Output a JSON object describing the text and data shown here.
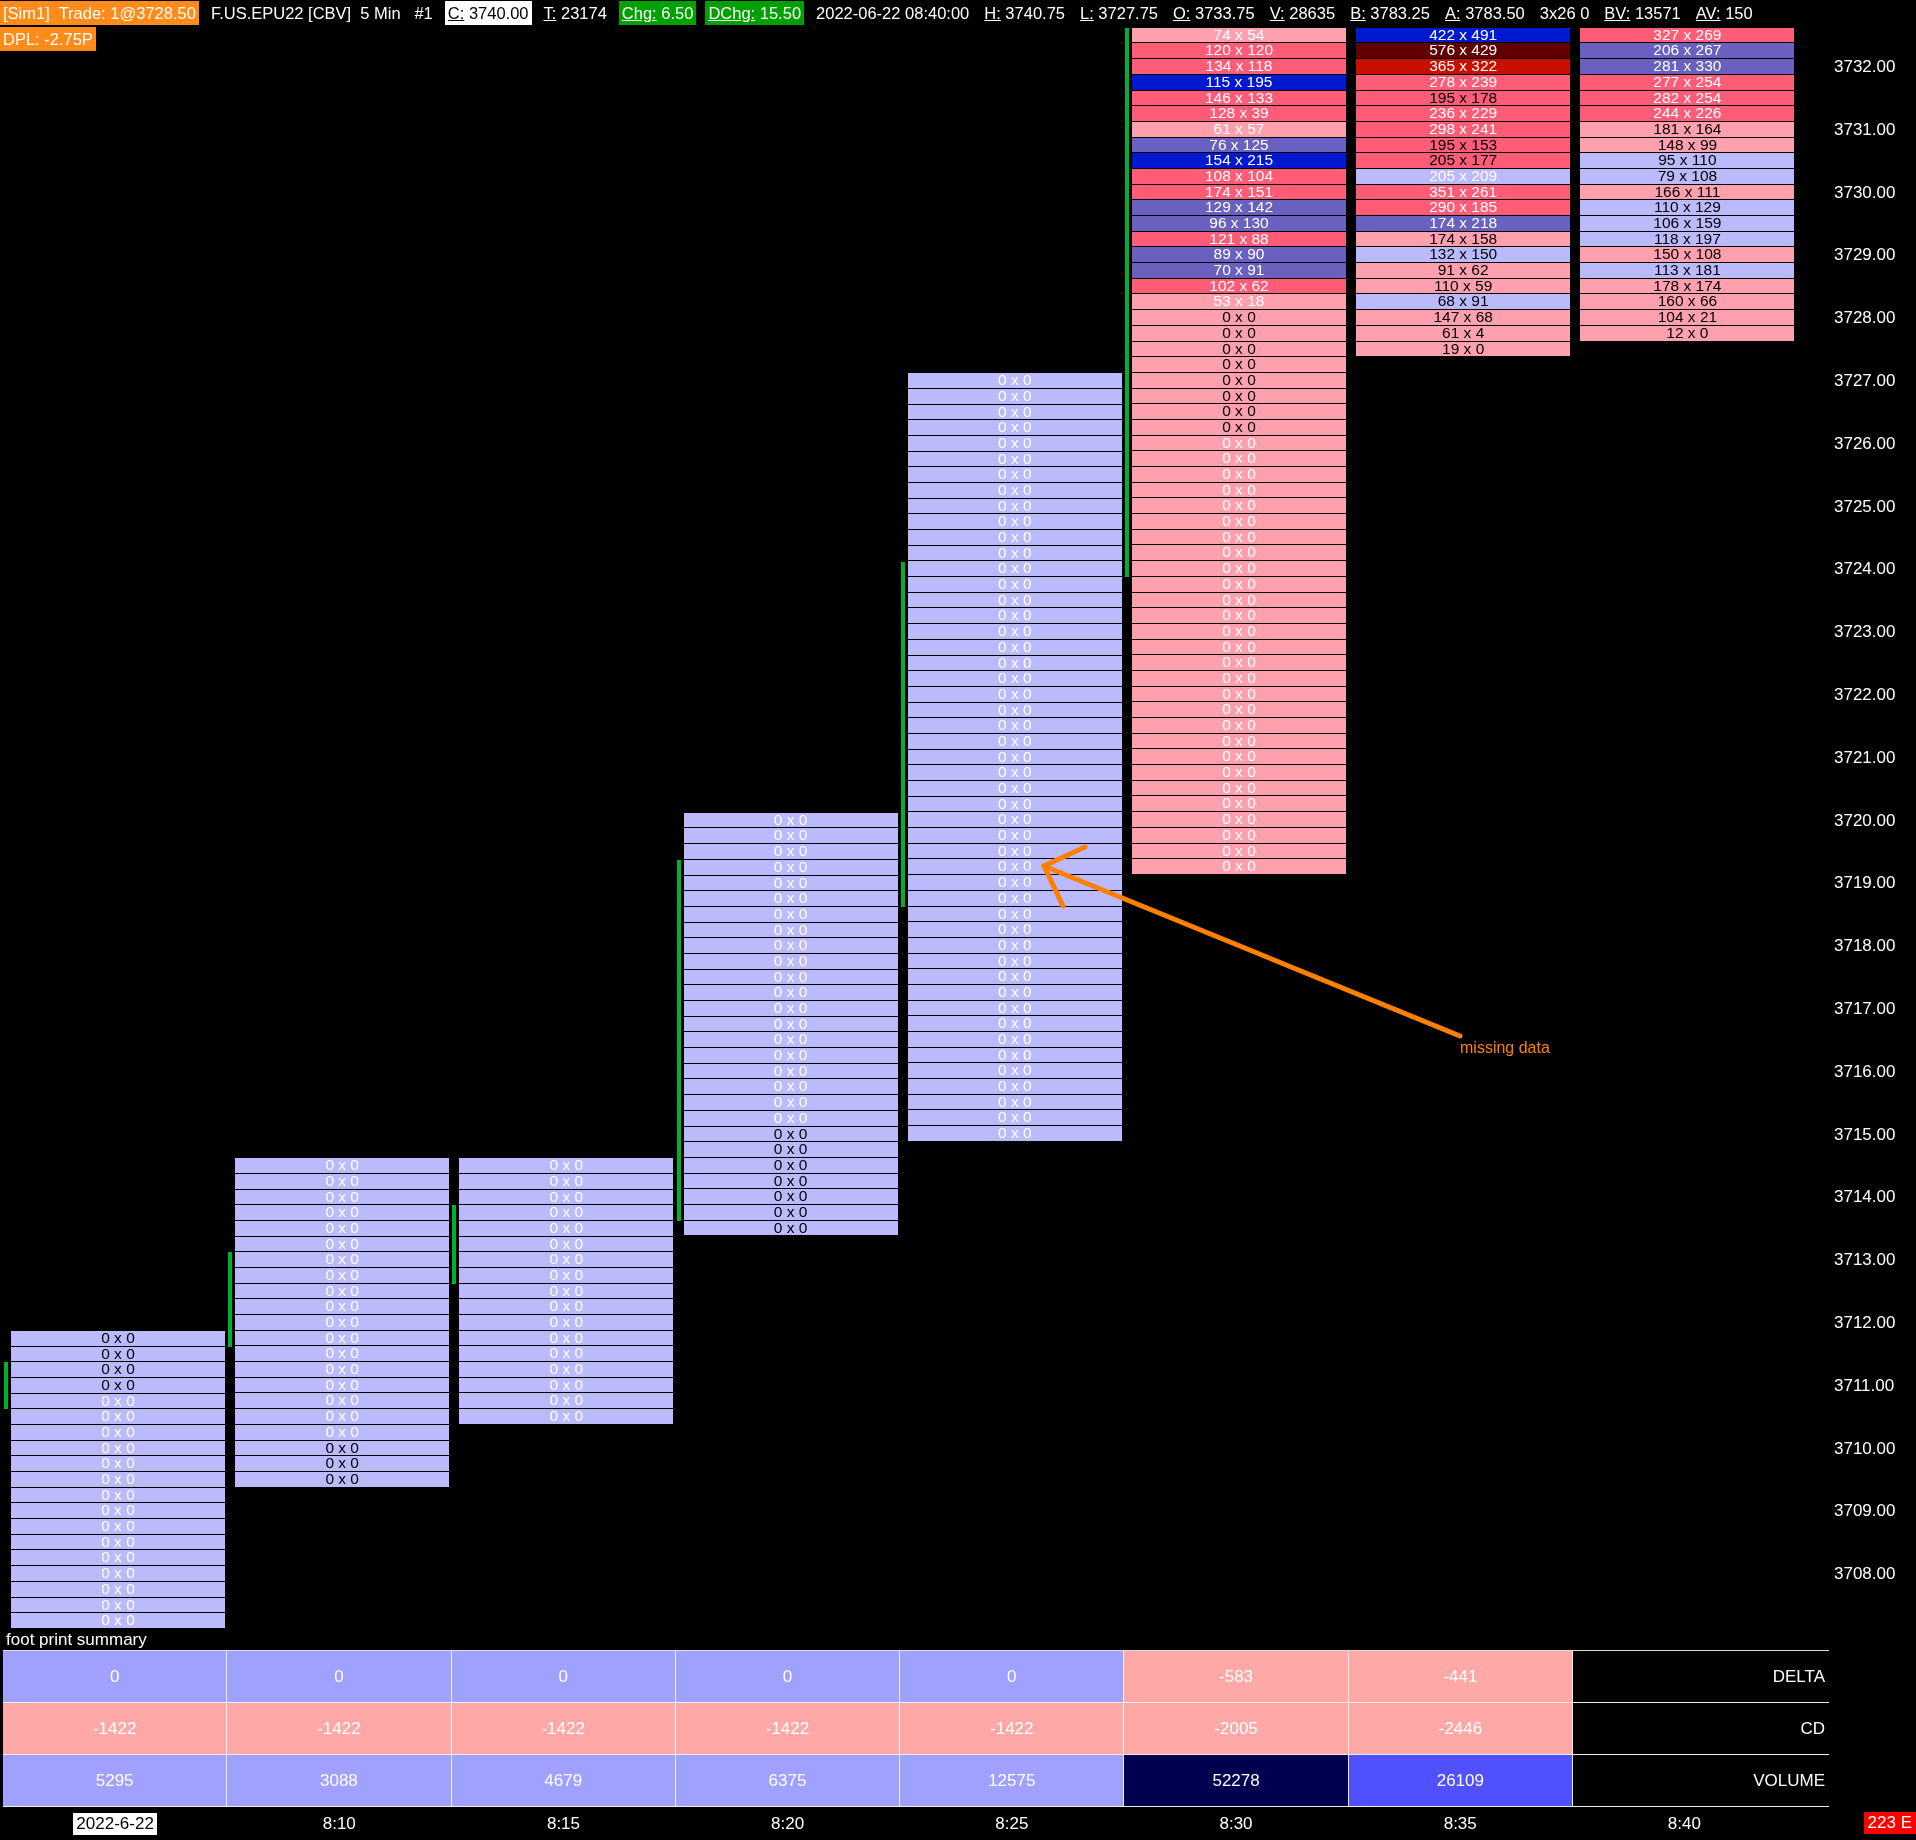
{
  "header": {
    "items": [
      {
        "value": "[Sim1]  Trade: 1@3728.50",
        "kind": "orange"
      },
      {
        "value": "F.US.EPU22 [CBV]  5 Min   #1",
        "kind": "plain"
      },
      {
        "label": "C:",
        "value": " 3740.00",
        "kind": "white"
      },
      {
        "label": "T:",
        "value": " 23174",
        "kind": "plain"
      },
      {
        "label": "Chg:",
        "value": " 6.50",
        "kind": "green"
      },
      {
        "label": "DChg:",
        "value": " 15.50",
        "kind": "green"
      },
      {
        "value": "2022-06-22 08:40:00",
        "kind": "plain"
      },
      {
        "label": "H:",
        "value": " 3740.75",
        "kind": "plain"
      },
      {
        "label": "L:",
        "value": " 3727.75",
        "kind": "plain"
      },
      {
        "label": "O:",
        "value": " 3733.75",
        "kind": "plain"
      },
      {
        "label": "V:",
        "value": " 28635",
        "kind": "plain"
      },
      {
        "label": "B:",
        "value": " 3783.25",
        "kind": "plain"
      },
      {
        "label": "A:",
        "value": " 3783.50",
        "kind": "plain"
      },
      {
        "value": "3x26 0",
        "kind": "plain"
      },
      {
        "label": "BV:",
        "value": " 13571",
        "kind": "plain"
      },
      {
        "label": "AV:",
        "value": " 150",
        "kind": "plain"
      }
    ],
    "second_line": {
      "value": "DPL: -2.75P",
      "kind": "orange"
    }
  },
  "bars": [
    {
      "cells": [
        {
          "text": "0 x 0",
          "color": "#babafc",
          "dark": true
        },
        {
          "text": "0 x 0",
          "color": "#babafc",
          "dark": true
        },
        {
          "text": "0 x 0",
          "color": "#babafc",
          "dark": true
        },
        {
          "text": "0 x 0",
          "color": "#babafc",
          "dark": true
        },
        {
          "text": "0 x 0",
          "color": "#babafc",
          "dark": false
        },
        {
          "text": "0 x 0",
          "color": "#babafc",
          "dark": false
        },
        {
          "text": "0 x 0",
          "color": "#babafc",
          "dark": false
        },
        {
          "text": "0 x 0",
          "color": "#babafc",
          "dark": false
        },
        {
          "text": "0 x 0",
          "color": "#babafc",
          "dark": false
        },
        {
          "text": "0 x 0",
          "color": "#babafc",
          "dark": false
        },
        {
          "text": "0 x 0",
          "color": "#babafc",
          "dark": false
        },
        {
          "text": "0 x 0",
          "color": "#babafc",
          "dark": false
        },
        {
          "text": "0 x 0",
          "color": "#babafc",
          "dark": false
        },
        {
          "text": "0 x 0",
          "color": "#babafc",
          "dark": false
        },
        {
          "text": "0 x 0",
          "color": "#babafc",
          "dark": false
        },
        {
          "text": "0 x 0",
          "color": "#babafc",
          "dark": false
        },
        {
          "text": "0 x 0",
          "color": "#babafc",
          "dark": false
        },
        {
          "text": "0 x 0",
          "color": "#babafc",
          "dark": false
        },
        {
          "text": "0 x 0",
          "color": "#babafc",
          "dark": false
        }
      ]
    },
    {
      "cells": [
        {
          "text": "0 x 0",
          "color": "#babafc",
          "dark": false
        },
        {
          "text": "0 x 0",
          "color": "#babafc",
          "dark": false
        },
        {
          "text": "0 x 0",
          "color": "#babafc",
          "dark": false
        },
        {
          "text": "0 x 0",
          "color": "#babafc",
          "dark": false
        },
        {
          "text": "0 x 0",
          "color": "#babafc",
          "dark": false
        },
        {
          "text": "0 x 0",
          "color": "#babafc",
          "dark": false
        },
        {
          "text": "0 x 0",
          "color": "#babafc",
          "dark": false
        },
        {
          "text": "0 x 0",
          "color": "#babafc",
          "dark": false
        },
        {
          "text": "0 x 0",
          "color": "#babafc",
          "dark": false
        },
        {
          "text": "0 x 0",
          "color": "#babafc",
          "dark": false
        },
        {
          "text": "0 x 0",
          "color": "#babafc",
          "dark": false
        },
        {
          "text": "0 x 0",
          "color": "#babafc",
          "dark": false
        },
        {
          "text": "0 x 0",
          "color": "#babafc",
          "dark": false
        },
        {
          "text": "0 x 0",
          "color": "#babafc",
          "dark": false
        },
        {
          "text": "0 x 0",
          "color": "#babafc",
          "dark": false
        },
        {
          "text": "0 x 0",
          "color": "#babafc",
          "dark": false
        },
        {
          "text": "0 x 0",
          "color": "#babafc",
          "dark": false
        },
        {
          "text": "0 x 0",
          "color": "#babafc",
          "dark": false
        },
        {
          "text": "0 x 0",
          "color": "#babafc",
          "dark": true
        },
        {
          "text": "0 x 0",
          "color": "#babafc",
          "dark": true
        },
        {
          "text": "0 x 0",
          "color": "#babafc",
          "dark": true
        }
      ]
    },
    {
      "cells": [
        {
          "text": "0 x 0",
          "color": "#babafc",
          "dark": false
        },
        {
          "text": "0 x 0",
          "color": "#babafc",
          "dark": false
        },
        {
          "text": "0 x 0",
          "color": "#babafc",
          "dark": false
        },
        {
          "text": "0 x 0",
          "color": "#babafc",
          "dark": false
        },
        {
          "text": "0 x 0",
          "color": "#babafc",
          "dark": false
        },
        {
          "text": "0 x 0",
          "color": "#babafc",
          "dark": false
        },
        {
          "text": "0 x 0",
          "color": "#babafc",
          "dark": false
        },
        {
          "text": "0 x 0",
          "color": "#babafc",
          "dark": false
        },
        {
          "text": "0 x 0",
          "color": "#babafc",
          "dark": false
        },
        {
          "text": "0 x 0",
          "color": "#babafc",
          "dark": false
        },
        {
          "text": "0 x 0",
          "color": "#babafc",
          "dark": false
        },
        {
          "text": "0 x 0",
          "color": "#babafc",
          "dark": false
        },
        {
          "text": "0 x 0",
          "color": "#babafc",
          "dark": false
        },
        {
          "text": "0 x 0",
          "color": "#babafc",
          "dark": false
        },
        {
          "text": "0 x 0",
          "color": "#babafc",
          "dark": false
        },
        {
          "text": "0 x 0",
          "color": "#babafc",
          "dark": false
        },
        {
          "text": "0 x 0",
          "color": "#babafc",
          "dark": false
        }
      ]
    },
    {
      "cells": [
        {
          "text": "0 x 0",
          "color": "#babafc",
          "dark": false
        },
        {
          "text": "0 x 0",
          "color": "#babafc",
          "dark": false
        },
        {
          "text": "0 x 0",
          "color": "#babafc",
          "dark": false
        },
        {
          "text": "0 x 0",
          "color": "#babafc",
          "dark": false
        },
        {
          "text": "0 x 0",
          "color": "#babafc",
          "dark": false
        },
        {
          "text": "0 x 0",
          "color": "#babafc",
          "dark": false
        },
        {
          "text": "0 x 0",
          "color": "#babafc",
          "dark": false
        },
        {
          "text": "0 x 0",
          "color": "#babafc",
          "dark": false
        },
        {
          "text": "0 x 0",
          "color": "#babafc",
          "dark": false
        },
        {
          "text": "0 x 0",
          "color": "#babafc",
          "dark": false
        },
        {
          "text": "0 x 0",
          "color": "#babafc",
          "dark": false
        },
        {
          "text": "0 x 0",
          "color": "#babafc",
          "dark": false
        },
        {
          "text": "0 x 0",
          "color": "#babafc",
          "dark": false
        },
        {
          "text": "0 x 0",
          "color": "#babafc",
          "dark": false
        },
        {
          "text": "0 x 0",
          "color": "#babafc",
          "dark": false
        },
        {
          "text": "0 x 0",
          "color": "#babafc",
          "dark": false
        },
        {
          "text": "0 x 0",
          "color": "#babafc",
          "dark": false
        },
        {
          "text": "0 x 0",
          "color": "#babafc",
          "dark": false
        },
        {
          "text": "0 x 0",
          "color": "#babafc",
          "dark": false
        },
        {
          "text": "0 x 0",
          "color": "#babafc",
          "dark": false
        },
        {
          "text": "0 x 0",
          "color": "#babafc",
          "dark": true
        },
        {
          "text": "0 x 0",
          "color": "#babafc",
          "dark": true
        },
        {
          "text": "0 x 0",
          "color": "#babafc",
          "dark": true
        },
        {
          "text": "0 x 0",
          "color": "#babafc",
          "dark": true
        },
        {
          "text": "0 x 0",
          "color": "#babafc",
          "dark": true
        },
        {
          "text": "0 x 0",
          "color": "#babafc",
          "dark": true
        },
        {
          "text": "0 x 0",
          "color": "#babafc",
          "dark": true
        }
      ]
    },
    {
      "cells": [
        {
          "text": "0 x 0",
          "color": "#babafc",
          "dark": false
        },
        {
          "text": "0 x 0",
          "color": "#babafc",
          "dark": false
        },
        {
          "text": "0 x 0",
          "color": "#babafc",
          "dark": false
        },
        {
          "text": "0 x 0",
          "color": "#babafc",
          "dark": false
        },
        {
          "text": "0 x 0",
          "color": "#babafc",
          "dark": false
        },
        {
          "text": "0 x 0",
          "color": "#babafc",
          "dark": false
        },
        {
          "text": "0 x 0",
          "color": "#babafc",
          "dark": false
        },
        {
          "text": "0 x 0",
          "color": "#babafc",
          "dark": false
        },
        {
          "text": "0 x 0",
          "color": "#babafc",
          "dark": false
        },
        {
          "text": "0 x 0",
          "color": "#babafc",
          "dark": false
        },
        {
          "text": "0 x 0",
          "color": "#babafc",
          "dark": false
        },
        {
          "text": "0 x 0",
          "color": "#babafc",
          "dark": false
        },
        {
          "text": "0 x 0",
          "color": "#babafc",
          "dark": false
        },
        {
          "text": "0 x 0",
          "color": "#babafc",
          "dark": false
        },
        {
          "text": "0 x 0",
          "color": "#babafc",
          "dark": false
        },
        {
          "text": "0 x 0",
          "color": "#babafc",
          "dark": false
        },
        {
          "text": "0 x 0",
          "color": "#babafc",
          "dark": false
        },
        {
          "text": "0 x 0",
          "color": "#babafc",
          "dark": false
        },
        {
          "text": "0 x 0",
          "color": "#babafc",
          "dark": false
        },
        {
          "text": "0 x 0",
          "color": "#babafc",
          "dark": false
        },
        {
          "text": "0 x 0",
          "color": "#babafc",
          "dark": false
        },
        {
          "text": "0 x 0",
          "color": "#babafc",
          "dark": false
        },
        {
          "text": "0 x 0",
          "color": "#babafc",
          "dark": false
        },
        {
          "text": "0 x 0",
          "color": "#babafc",
          "dark": false
        },
        {
          "text": "0 x 0",
          "color": "#babafc",
          "dark": false
        },
        {
          "text": "0 x 0",
          "color": "#babafc",
          "dark": false
        },
        {
          "text": "0 x 0",
          "color": "#babafc",
          "dark": false
        },
        {
          "text": "0 x 0",
          "color": "#babafc",
          "dark": false
        },
        {
          "text": "0 x 0",
          "color": "#babafc",
          "dark": false
        },
        {
          "text": "0 x 0",
          "color": "#babafc",
          "dark": false
        },
        {
          "text": "0 x 0",
          "color": "#babafc",
          "dark": false
        },
        {
          "text": "0 x 0",
          "color": "#babafc",
          "dark": false
        },
        {
          "text": "0 x 0",
          "color": "#babafc",
          "dark": false
        },
        {
          "text": "0 x 0",
          "color": "#babafc",
          "dark": false
        },
        {
          "text": "0 x 0",
          "color": "#babafc",
          "dark": false
        },
        {
          "text": "0 x 0",
          "color": "#babafc",
          "dark": false
        },
        {
          "text": "0 x 0",
          "color": "#babafc",
          "dark": false
        },
        {
          "text": "0 x 0",
          "color": "#babafc",
          "dark": false
        },
        {
          "text": "0 x 0",
          "color": "#babafc",
          "dark": false
        },
        {
          "text": "0 x 0",
          "color": "#babafc",
          "dark": false
        },
        {
          "text": "0 x 0",
          "color": "#babafc",
          "dark": false
        },
        {
          "text": "0 x 0",
          "color": "#babafc",
          "dark": false
        },
        {
          "text": "0 x 0",
          "color": "#babafc",
          "dark": false
        },
        {
          "text": "0 x 0",
          "color": "#babafc",
          "dark": false
        },
        {
          "text": "0 x 0",
          "color": "#babafc",
          "dark": false
        },
        {
          "text": "0 x 0",
          "color": "#babafc",
          "dark": false
        },
        {
          "text": "0 x 0",
          "color": "#babafc",
          "dark": false
        },
        {
          "text": "0 x 0",
          "color": "#babafc",
          "dark": false
        },
        {
          "text": "0 x 0",
          "color": "#babafc",
          "dark": false
        }
      ]
    },
    {
      "cells": [
        {
          "text": "74 x 54",
          "color": "#ffa0ae",
          "dark": false
        },
        {
          "text": "120 x 120",
          "color": "#ff5c78",
          "dark": false
        },
        {
          "text": "134 x 118",
          "color": "#ff5c78",
          "dark": false
        },
        {
          "text": "115 x 195",
          "color": "#0018d0",
          "dark": false
        },
        {
          "text": "146 x 133",
          "color": "#ff5c78",
          "dark": false
        },
        {
          "text": "128 x 39",
          "color": "#ff5c78",
          "dark": false
        },
        {
          "text": "61 x 57",
          "color": "#ffa0ae",
          "dark": false
        },
        {
          "text": "76 x 125",
          "color": "#6a60c0",
          "dark": false
        },
        {
          "text": "154 x 215",
          "color": "#0018d0",
          "dark": false
        },
        {
          "text": "108 x 104",
          "color": "#ff5c78",
          "dark": false
        },
        {
          "text": "174 x 151",
          "color": "#ff5c78",
          "dark": false
        },
        {
          "text": "129 x 142",
          "color": "#6a60c0",
          "dark": false
        },
        {
          "text": "96 x 130",
          "color": "#6a60c0",
          "dark": false
        },
        {
          "text": "121 x 88",
          "color": "#ff5c78",
          "dark": false
        },
        {
          "text": "89 x 90",
          "color": "#6a60c0",
          "dark": false
        },
        {
          "text": "70 x 91",
          "color": "#6a60c0",
          "dark": false
        },
        {
          "text": "102 x 62",
          "color": "#ff5c78",
          "dark": false
        },
        {
          "text": "53 x 18",
          "color": "#ffa0ae",
          "dark": false
        },
        {
          "text": "0 x 0",
          "color": "#ffa0ae",
          "dark": true
        },
        {
          "text": "0 x 0",
          "color": "#ffa0ae",
          "dark": true
        },
        {
          "text": "0 x 0",
          "color": "#ffa0ae",
          "dark": true
        },
        {
          "text": "0 x 0",
          "color": "#ffa0ae",
          "dark": true
        },
        {
          "text": "0 x 0",
          "color": "#ffa0ae",
          "dark": true
        },
        {
          "text": "0 x 0",
          "color": "#ffa0ae",
          "dark": true
        },
        {
          "text": "0 x 0",
          "color": "#ffa0ae",
          "dark": true
        },
        {
          "text": "0 x 0",
          "color": "#ffa0ae",
          "dark": true
        },
        {
          "text": "0 x 0",
          "color": "#ffa0ae",
          "dark": false
        },
        {
          "text": "0 x 0",
          "color": "#ffa0ae",
          "dark": false
        },
        {
          "text": "0 x 0",
          "color": "#ffa0ae",
          "dark": false
        },
        {
          "text": "0 x 0",
          "color": "#ffa0ae",
          "dark": false
        },
        {
          "text": "0 x 0",
          "color": "#ffa0ae",
          "dark": false
        },
        {
          "text": "0 x 0",
          "color": "#ffa0ae",
          "dark": false
        },
        {
          "text": "0 x 0",
          "color": "#ffa0ae",
          "dark": false
        },
        {
          "text": "0 x 0",
          "color": "#ffa0ae",
          "dark": false
        },
        {
          "text": "0 x 0",
          "color": "#ffa0ae",
          "dark": false
        },
        {
          "text": "0 x 0",
          "color": "#ffa0ae",
          "dark": false
        },
        {
          "text": "0 x 0",
          "color": "#ffa0ae",
          "dark": false
        },
        {
          "text": "0 x 0",
          "color": "#ffa0ae",
          "dark": false
        },
        {
          "text": "0 x 0",
          "color": "#ffa0ae",
          "dark": false
        },
        {
          "text": "0 x 0",
          "color": "#ffa0ae",
          "dark": false
        },
        {
          "text": "0 x 0",
          "color": "#ffa0ae",
          "dark": false
        },
        {
          "text": "0 x 0",
          "color": "#ffa0ae",
          "dark": false
        },
        {
          "text": "0 x 0",
          "color": "#ffa0ae",
          "dark": false
        },
        {
          "text": "0 x 0",
          "color": "#ffa0ae",
          "dark": false
        },
        {
          "text": "0 x 0",
          "color": "#ffa0ae",
          "dark": false
        },
        {
          "text": "0 x 0",
          "color": "#ffa0ae",
          "dark": false
        },
        {
          "text": "0 x 0",
          "color": "#ffa0ae",
          "dark": false
        },
        {
          "text": "0 x 0",
          "color": "#ffa0ae",
          "dark": false
        },
        {
          "text": "0 x 0",
          "color": "#ffa0ae",
          "dark": false
        },
        {
          "text": "0 x 0",
          "color": "#ffa0ae",
          "dark": false
        },
        {
          "text": "0 x 0",
          "color": "#ffa0ae",
          "dark": false
        },
        {
          "text": "0 x 0",
          "color": "#ffa0ae",
          "dark": false
        },
        {
          "text": "0 x 0",
          "color": "#ffa0ae",
          "dark": false
        },
        {
          "text": "0 x 0",
          "color": "#ffa0ae",
          "dark": false
        }
      ]
    },
    {
      "cells": [
        {
          "text": "422 x 491",
          "color": "#0018d0",
          "dark": false
        },
        {
          "text": "576 x 429",
          "color": "#600000",
          "dark": false
        },
        {
          "text": "365 x 322",
          "color": "#c81000",
          "dark": false
        },
        {
          "text": "278 x 239",
          "color": "#ff5c78",
          "dark": false
        },
        {
          "text": "195 x 178",
          "color": "#ff5c78",
          "dark": true
        },
        {
          "text": "236 x 229",
          "color": "#ff5c78",
          "dark": false
        },
        {
          "text": "298 x 241",
          "color": "#ff5c78",
          "dark": false
        },
        {
          "text": "195 x 153",
          "color": "#ff5c78",
          "dark": true
        },
        {
          "text": "205 x 177",
          "color": "#ff5c78",
          "dark": true
        },
        {
          "text": "205 x 209",
          "color": "#babafc",
          "dark": false
        },
        {
          "text": "351 x 261",
          "color": "#ff5c78",
          "dark": false
        },
        {
          "text": "290 x 185",
          "color": "#ff5c78",
          "dark": false
        },
        {
          "text": "174 x 218",
          "color": "#6a60c0",
          "dark": false
        },
        {
          "text": "174 x 158",
          "color": "#ffa0ae",
          "dark": true
        },
        {
          "text": "132 x 150",
          "color": "#babafc",
          "dark": true
        },
        {
          "text": "91 x 62",
          "color": "#ffa0ae",
          "dark": true
        },
        {
          "text": "110 x 59",
          "color": "#ffa0ae",
          "dark": true
        },
        {
          "text": "68 x 91",
          "color": "#babafc",
          "dark": true
        },
        {
          "text": "147 x 68",
          "color": "#ffa0ae",
          "dark": true
        },
        {
          "text": "61 x 4",
          "color": "#ffa0ae",
          "dark": true
        },
        {
          "text": "19 x 0",
          "color": "#ffa0ae",
          "dark": true
        }
      ]
    },
    {
      "cells": [
        {
          "text": "327 x 269",
          "color": "#ff5c78",
          "dark": false
        },
        {
          "text": "206 x 267",
          "color": "#6a60c0",
          "dark": false
        },
        {
          "text": "281 x 330",
          "color": "#6a60c0",
          "dark": false
        },
        {
          "text": "277 x 254",
          "color": "#ff5c78",
          "dark": false
        },
        {
          "text": "282 x 254",
          "color": "#ff5c78",
          "dark": false
        },
        {
          "text": "244 x 226",
          "color": "#ff5c78",
          "dark": false
        },
        {
          "text": "181 x 164",
          "color": "#ffa0ae",
          "dark": true
        },
        {
          "text": "148 x 99",
          "color": "#ffa0ae",
          "dark": true
        },
        {
          "text": "95 x 110",
          "color": "#babafc",
          "dark": true
        },
        {
          "text": "79 x 108",
          "color": "#babafc",
          "dark": true
        },
        {
          "text": "166 x 111",
          "color": "#ffa0ae",
          "dark": true
        },
        {
          "text": "110 x 129",
          "color": "#babafc",
          "dark": true
        },
        {
          "text": "106 x 159",
          "color": "#babafc",
          "dark": true
        },
        {
          "text": "118 x 197",
          "color": "#babafc",
          "dark": true
        },
        {
          "text": "150 x 108",
          "color": "#ffa0ae",
          "dark": true
        },
        {
          "text": "113 x 181",
          "color": "#babafc",
          "dark": true
        },
        {
          "text": "178 x 174",
          "color": "#ffa0ae",
          "dark": true
        },
        {
          "text": "160 x 66",
          "color": "#ffa0ae",
          "dark": true
        },
        {
          "text": "104 x 21",
          "color": "#ffa0ae",
          "dark": true
        },
        {
          "text": "12 x 0",
          "color": "#ffa0ae",
          "dark": true
        }
      ]
    }
  ],
  "price_axis": [
    "3732.00",
    "3731.00",
    "3730.00",
    "3729.00",
    "3728.00",
    "3727.00",
    "3726.00",
    "3725.00",
    "3724.00",
    "3723.00",
    "3722.00",
    "3721.00",
    "3720.00",
    "3719.00",
    "3718.00",
    "3717.00",
    "3716.00",
    "3715.00",
    "3714.00",
    "3713.00",
    "3712.00",
    "3711.00",
    "3710.00",
    "3709.00",
    "3708.00"
  ],
  "annotation": {
    "text": "missing data"
  },
  "summary": {
    "title": "foot print summary",
    "rows": [
      {
        "label": "DELTA",
        "cells": [
          {
            "text": "0",
            "color": "#a0a0ff"
          },
          {
            "text": "0",
            "color": "#a0a0ff"
          },
          {
            "text": "0",
            "color": "#a0a0ff"
          },
          {
            "text": "0",
            "color": "#a0a0ff"
          },
          {
            "text": "0",
            "color": "#a0a0ff"
          },
          {
            "text": "-583",
            "color": "#ffa8a8"
          },
          {
            "text": "-441",
            "color": "#ffa8a8"
          }
        ]
      },
      {
        "label": "CD",
        "cells": [
          {
            "text": "-1422",
            "color": "#ffa8a8"
          },
          {
            "text": "-1422",
            "color": "#ffa8a8"
          },
          {
            "text": "-1422",
            "color": "#ffa8a8"
          },
          {
            "text": "-1422",
            "color": "#ffa8a8"
          },
          {
            "text": "-1422",
            "color": "#ffa8a8"
          },
          {
            "text": "-2005",
            "color": "#ffa8a8"
          },
          {
            "text": "-2446",
            "color": "#ffa8a8"
          }
        ]
      },
      {
        "label": "VOLUME",
        "cells": [
          {
            "text": "5295",
            "color": "#a0a0ff"
          },
          {
            "text": "3088",
            "color": "#a0a0ff"
          },
          {
            "text": "4679",
            "color": "#a0a0ff"
          },
          {
            "text": "6375",
            "color": "#a0a0ff"
          },
          {
            "text": "12575",
            "color": "#a0a0ff"
          },
          {
            "text": "52278",
            "color": "#000050"
          },
          {
            "text": "26109",
            "color": "#5050ff"
          }
        ]
      }
    ]
  },
  "time_axis": [
    {
      "text": "2022-6-22",
      "kind": "date"
    },
    {
      "text": "8:10",
      "kind": "time"
    },
    {
      "text": "8:15",
      "kind": "time"
    },
    {
      "text": "8:20",
      "kind": "time"
    },
    {
      "text": "8:25",
      "kind": "time"
    },
    {
      "text": "8:30",
      "kind": "time"
    },
    {
      "text": "8:35",
      "kind": "time"
    },
    {
      "text": "8:40",
      "kind": "time"
    }
  ],
  "price_marker": {
    "text": "223 E"
  }
}
